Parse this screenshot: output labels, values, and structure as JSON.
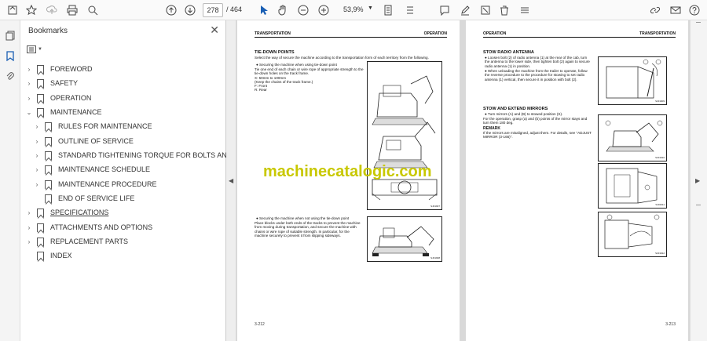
{
  "toolbar": {
    "current_page": "278",
    "page_separator": "/",
    "total_pages": "464",
    "zoom": "53,9%"
  },
  "bookmarks": {
    "title": "Bookmarks",
    "items": [
      {
        "label": "FOREWORD"
      },
      {
        "label": "SAFETY"
      },
      {
        "label": "OPERATION"
      },
      {
        "label": "MAINTENANCE"
      },
      {
        "label": "RULES FOR MAINTENANCE"
      },
      {
        "label": "OUTLINE OF SERVICE"
      },
      {
        "label": "STANDARD TIGHTENING TORQUE FOR BOLTS AND NUTS"
      },
      {
        "label": "MAINTENANCE SCHEDULE"
      },
      {
        "label": "MAINTENANCE PROCEDURE"
      },
      {
        "label": "END OF SERVICE LIFE"
      },
      {
        "label": "SPECIFICATIONS"
      },
      {
        "label": "ATTACHMENTS AND OPTIONS"
      },
      {
        "label": "REPLACEMENT PARTS"
      },
      {
        "label": "INDEX"
      }
    ]
  },
  "watermark": "machinecatalogic.com",
  "left_page": {
    "header_left": "TRANSPORTATION",
    "header_right": "OPERATION",
    "section_title": "TIE-DOWN POINTS",
    "intro": "Select the way of secure the machine according to the transportation form of each territory from the following.",
    "bullet1": "● Securing the machine when using tie-down point",
    "para1": "Tie one end of each chain or wire rope of appropriate strength to the tie-down holes on the track frame.",
    "para1b": "X: 50mm to 100mm",
    "para1c": "(Keep the chains of the track frame.)",
    "para1d": "F: Front",
    "para1e": "R: Rear",
    "fig1_label": "SJ01907",
    "bullet2": "● Securing the machine when not using the tie-down point",
    "para2": "Place blocks under both ends of the tracks to prevent the machine from moving during transportation, and secure the machine with chains or wire rope of suitable strength. In particular, for the machine securely to prevent it from slipping sideways.",
    "fig2_label": "SJ01908",
    "page_number": "3-212"
  },
  "right_page": {
    "header_left": "OPERATION",
    "header_right": "TRANSPORTATION",
    "title1": "STOW RADIO ANTENNA",
    "bullets1": "● Loosen bolt (2) of radio antenna (1) at the rear of the cab, turn the antenna to the lower side, then tighten bolt (2) again to secure radio antenna (1) in position.",
    "bullets1b": "● When unloading the machine from the trailer to operate, follow the reverse procedure to the procedure for stowing to set radio antenna (1) vertical, then secure it in position with bolt (2).",
    "title2": "STOW AND EXTEND MIRRORS",
    "bullets2": "● Turn mirrors (A) and (B) to stowed position (S).",
    "para2": "For the operation, grasp (a) and (b) points of the mirror stays and turn them 180 deg.",
    "remark": "REMARK",
    "remark_text": "If the mirrors are misaligned, adjust them. For details, see \"ADJUST MIRROR (3-166)\".",
    "fig1_label": "SJ01909",
    "fig2_label": "SJ01910",
    "fig3_label": "SJ01911",
    "fig4_label": "SJ01912",
    "page_number": "3-213"
  }
}
